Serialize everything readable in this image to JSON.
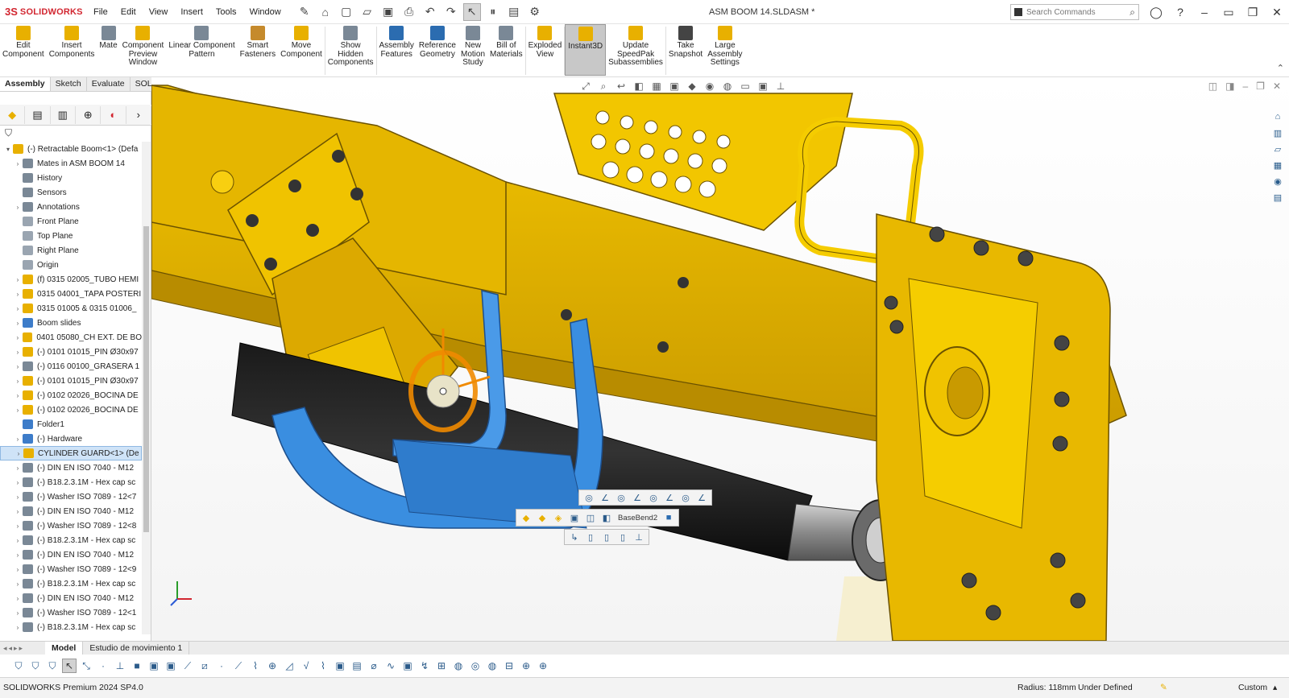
{
  "app": {
    "brand_ds": "3S",
    "brand_name": "SOLIDWORKS",
    "document_title": "ASM BOOM 14.SLDASM *"
  },
  "menu": [
    "File",
    "Edit",
    "View",
    "Insert",
    "Tools",
    "Window"
  ],
  "search": {
    "placeholder": "Search Commands"
  },
  "ribbon": {
    "buttons": [
      {
        "label": "Edit\nComponent",
        "icon": "edit-component-icon",
        "color": "#e8b000"
      },
      {
        "label": "Insert\nComponents",
        "icon": "insert-components-icon",
        "color": "#e8b000"
      },
      {
        "label": "Mate",
        "icon": "mate-icon",
        "color": "#7a8896"
      },
      {
        "label": "Component\nPreview\nWindow",
        "icon": "preview-window-icon",
        "color": "#e8b000"
      },
      {
        "label": "Linear Component\nPattern",
        "icon": "linear-pattern-icon",
        "color": "#7a8896"
      },
      {
        "label": "Smart\nFasteners",
        "icon": "smart-fasteners-icon",
        "color": "#c58a2c"
      },
      {
        "label": "Move\nComponent",
        "icon": "move-component-icon",
        "color": "#e8b000"
      },
      {
        "label": "Show\nHidden\nComponents",
        "icon": "show-hidden-icon",
        "color": "#7a8896"
      },
      {
        "label": "Assembly\nFeatures",
        "icon": "assembly-features-icon",
        "color": "#2b6cb0"
      },
      {
        "label": "Reference\nGeometry",
        "icon": "reference-geometry-icon",
        "color": "#2b6cb0"
      },
      {
        "label": "New\nMotion\nStudy",
        "icon": "motion-study-icon",
        "color": "#7a8896"
      },
      {
        "label": "Bill of\nMaterials",
        "icon": "bom-icon",
        "color": "#7a8896"
      },
      {
        "label": "Exploded\nView",
        "icon": "exploded-view-icon",
        "color": "#e8b000"
      },
      {
        "label": "Instant3D",
        "icon": "instant3d-icon",
        "color": "#e8b000"
      },
      {
        "label": "Update\nSpeedPak\nSubassemblies",
        "icon": "speedpak-icon",
        "color": "#e8b000"
      },
      {
        "label": "Take\nSnapshot",
        "icon": "snapshot-icon",
        "color": "#444444"
      },
      {
        "label": "Large\nAssembly\nSettings",
        "icon": "large-assembly-icon",
        "color": "#e8b000"
      }
    ]
  },
  "command_tabs": [
    "Assembly",
    "Sketch",
    "Evaluate",
    "SOLIDWORKS Add-Ins"
  ],
  "tree": [
    {
      "label": "(-) Retractable Boom<1> (Defa",
      "icon": "assembly-icon",
      "arrow": "▾",
      "indent": 0,
      "color": "#e8b000"
    },
    {
      "label": "Mates in ASM BOOM 14",
      "icon": "mates-icon",
      "arrow": "›",
      "indent": 1,
      "color": "#7a8896"
    },
    {
      "label": "History",
      "icon": "history-icon",
      "arrow": "",
      "indent": 1,
      "color": "#7a8896"
    },
    {
      "label": "Sensors",
      "icon": "sensors-icon",
      "arrow": "",
      "indent": 1,
      "color": "#7a8896"
    },
    {
      "label": "Annotations",
      "icon": "annotations-icon",
      "arrow": "›",
      "indent": 1,
      "color": "#7a8896"
    },
    {
      "label": "Front Plane",
      "icon": "plane-icon",
      "arrow": "",
      "indent": 1,
      "color": "#9aa5b1"
    },
    {
      "label": "Top Plane",
      "icon": "plane-icon",
      "arrow": "",
      "indent": 1,
      "color": "#9aa5b1"
    },
    {
      "label": "Right Plane",
      "icon": "plane-icon",
      "arrow": "",
      "indent": 1,
      "color": "#9aa5b1"
    },
    {
      "label": "Origin",
      "icon": "origin-icon",
      "arrow": "",
      "indent": 1,
      "color": "#9aa5b1"
    },
    {
      "label": "(f) 0315 02005_TUBO HEMI",
      "icon": "part-icon",
      "arrow": "›",
      "indent": 1,
      "color": "#e8b000"
    },
    {
      "label": "0315 04001_TAPA POSTERI",
      "icon": "part-icon",
      "arrow": "›",
      "indent": 1,
      "color": "#e8b000"
    },
    {
      "label": "0315 01005 & 0315 01006_",
      "icon": "part-icon",
      "arrow": "›",
      "indent": 1,
      "color": "#e8b000"
    },
    {
      "label": "Boom slides",
      "icon": "folder-icon",
      "arrow": "›",
      "indent": 1,
      "color": "#3d7cc9"
    },
    {
      "label": "0401 05080_CH EXT. DE BO",
      "icon": "part-icon",
      "arrow": "›",
      "indent": 1,
      "color": "#e8b000"
    },
    {
      "label": "(-) 0101 01015_PIN Ø30x97",
      "icon": "part-icon",
      "arrow": "›",
      "indent": 1,
      "color": "#e8b000"
    },
    {
      "label": "(-) 0116 00100_GRASERA 1",
      "icon": "fastener-icon",
      "arrow": "›",
      "indent": 1,
      "color": "#7a8896"
    },
    {
      "label": "(-) 0101 01015_PIN Ø30x97",
      "icon": "part-icon",
      "arrow": "›",
      "indent": 1,
      "color": "#e8b000"
    },
    {
      "label": "(-) 0102 02026_BOCINA DE",
      "icon": "part-icon",
      "arrow": "›",
      "indent": 1,
      "color": "#e8b000"
    },
    {
      "label": "(-) 0102 02026_BOCINA DE",
      "icon": "part-icon",
      "arrow": "›",
      "indent": 1,
      "color": "#e8b000"
    },
    {
      "label": "Folder1",
      "icon": "folder-icon",
      "arrow": "",
      "indent": 1,
      "color": "#3d7cc9"
    },
    {
      "label": "(-) Hardware",
      "icon": "folder-icon",
      "arrow": "›",
      "indent": 1,
      "color": "#3d7cc9"
    },
    {
      "label": "CYLINDER GUARD<1> (De",
      "icon": "part-icon",
      "arrow": "›",
      "indent": 1,
      "color": "#e8b000",
      "selected": true
    },
    {
      "label": "(-) DIN EN ISO 7040 - M12",
      "icon": "fastener-icon",
      "arrow": "›",
      "indent": 1,
      "color": "#7a8896"
    },
    {
      "label": "(-) B18.2.3.1M - Hex cap sc",
      "icon": "fastener-icon",
      "arrow": "›",
      "indent": 1,
      "color": "#7a8896"
    },
    {
      "label": "(-) Washer ISO 7089 - 12<7",
      "icon": "fastener-icon",
      "arrow": "›",
      "indent": 1,
      "color": "#7a8896"
    },
    {
      "label": "(-) DIN EN ISO 7040 - M12",
      "icon": "fastener-icon",
      "arrow": "›",
      "indent": 1,
      "color": "#7a8896"
    },
    {
      "label": "(-) Washer ISO 7089 - 12<8",
      "icon": "fastener-icon",
      "arrow": "›",
      "indent": 1,
      "color": "#7a8896"
    },
    {
      "label": "(-) B18.2.3.1M - Hex cap sc",
      "icon": "fastener-icon",
      "arrow": "›",
      "indent": 1,
      "color": "#7a8896"
    },
    {
      "label": "(-) DIN EN ISO 7040 - M12",
      "icon": "fastener-icon",
      "arrow": "›",
      "indent": 1,
      "color": "#7a8896"
    },
    {
      "label": "(-) Washer ISO 7089 - 12<9",
      "icon": "fastener-icon",
      "arrow": "›",
      "indent": 1,
      "color": "#7a8896"
    },
    {
      "label": "(-) B18.2.3.1M - Hex cap sc",
      "icon": "fastener-icon",
      "arrow": "›",
      "indent": 1,
      "color": "#7a8896"
    },
    {
      "label": "(-) DIN EN ISO 7040 - M12",
      "icon": "fastener-icon",
      "arrow": "›",
      "indent": 1,
      "color": "#7a8896"
    },
    {
      "label": "(-) Washer ISO 7089 - 12<1",
      "icon": "fastener-icon",
      "arrow": "›",
      "indent": 1,
      "color": "#7a8896"
    },
    {
      "label": "(-) B18.2.3.1M - Hex cap sc",
      "icon": "fastener-icon",
      "arrow": "›",
      "indent": 1,
      "color": "#7a8896"
    }
  ],
  "context_toolbar": {
    "feature_label": "BaseBend2"
  },
  "bottom_tabs": [
    "Model",
    "Estudio de movimiento 1"
  ],
  "status": {
    "product": "SOLIDWORKS Premium 2024 SP4.0",
    "radius": "Radius: 118mm",
    "definition": "Under Defined",
    "units": "Custom"
  },
  "colors": {
    "yellow": "#e8b800",
    "blue": "#3a8ee0",
    "accent": "#d22630"
  }
}
